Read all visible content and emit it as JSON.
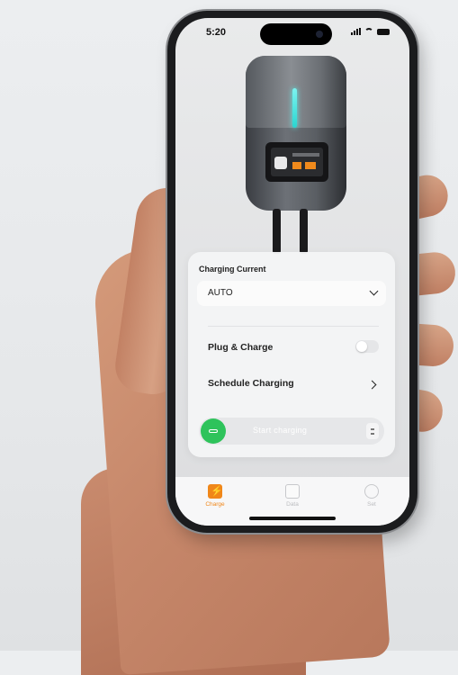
{
  "status_bar": {
    "time": "5:20"
  },
  "card": {
    "charging_current_label": "Charging Current",
    "charging_current_value": "AUTO",
    "plug_and_charge_label": "Plug & Charge",
    "plug_and_charge_enabled": false,
    "schedule_charging_label": "Schedule Charging",
    "slider_text": "Start charging"
  },
  "tabs": [
    {
      "label": "Charge",
      "icon": "charge-icon",
      "active": true,
      "color": "#f0871a"
    },
    {
      "label": "Data",
      "icon": "data-icon",
      "active": false,
      "color": "#c7c8cb"
    },
    {
      "label": "Set",
      "icon": "settings-icon",
      "active": false,
      "color": "#c7c8cb"
    }
  ],
  "colors": {
    "accent": "#f0871a",
    "slider_green": "#2ec35b",
    "led_cyan": "#2ad5d0"
  }
}
